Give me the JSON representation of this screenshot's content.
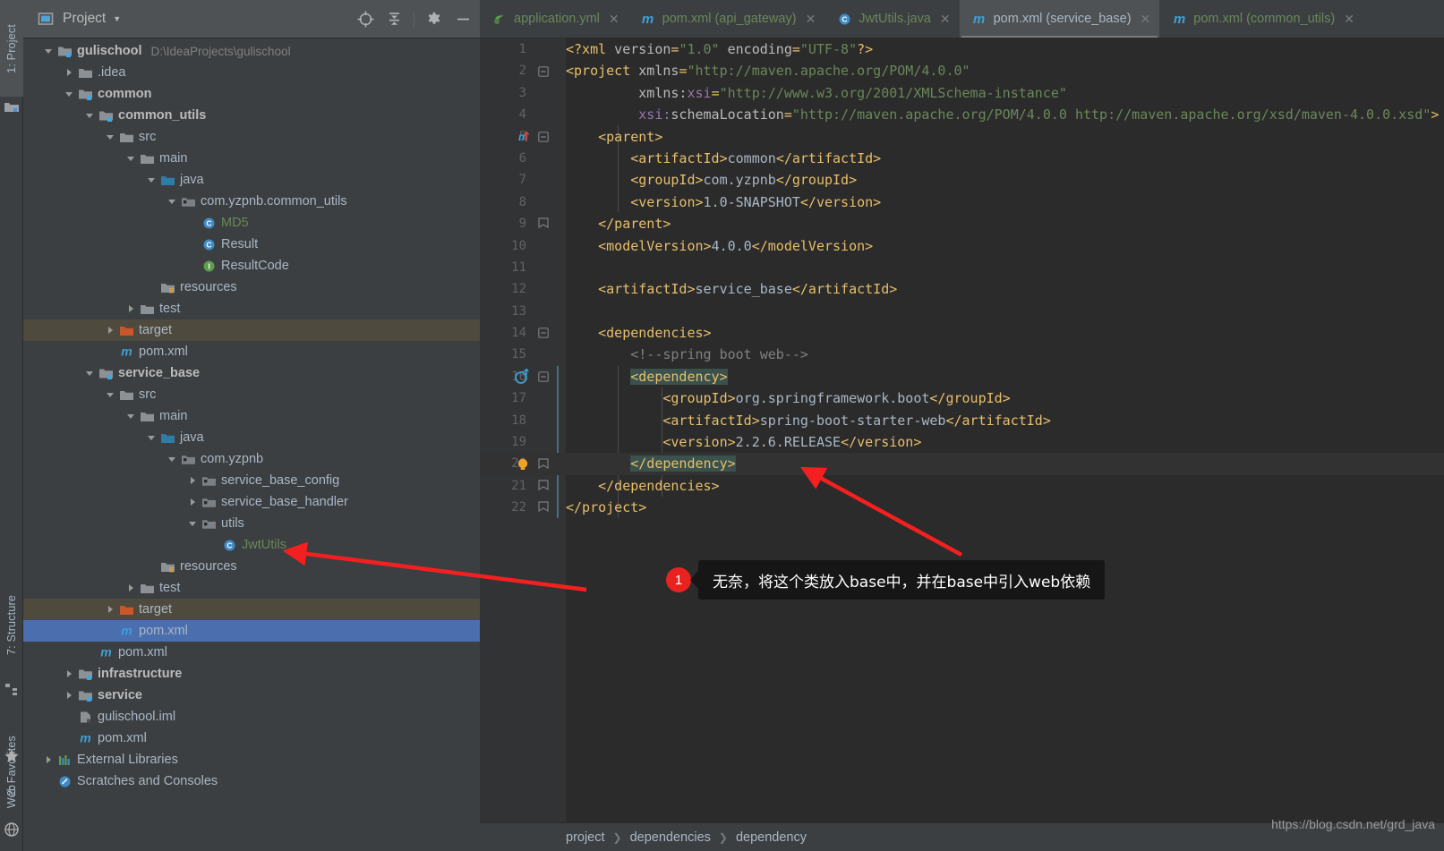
{
  "toolstrip": {
    "tabs": [
      {
        "label": "1: Project",
        "active": true,
        "icon": "project-icon"
      },
      {
        "label": "7: Structure",
        "active": false,
        "icon": "structure-icon"
      },
      {
        "label": "2: Favorites",
        "active": false,
        "icon": "star-icon"
      },
      {
        "label": "Web",
        "active": false,
        "icon": "web-icon"
      }
    ]
  },
  "project_panel": {
    "title": "Project",
    "tools": [
      {
        "name": "locate-icon",
        "title": "Select Opened File"
      },
      {
        "name": "collapse-all-icon",
        "title": "Collapse All"
      },
      {
        "name": "gear-icon",
        "title": "Settings"
      },
      {
        "name": "hide-icon",
        "title": "Hide"
      }
    ],
    "tree": [
      {
        "indent": 0,
        "twist": "open",
        "icon": "module-folder",
        "label": "gulischool",
        "style": "bold",
        "sub": "D:\\IdeaProjects\\gulischool",
        "state": ""
      },
      {
        "indent": 1,
        "twist": "closed",
        "icon": "folder",
        "label": ".idea",
        "style": "",
        "sub": "",
        "state": ""
      },
      {
        "indent": 1,
        "twist": "open",
        "icon": "module-folder",
        "label": "common",
        "style": "bold",
        "sub": "",
        "state": ""
      },
      {
        "indent": 2,
        "twist": "open",
        "icon": "module-folder",
        "label": "common_utils",
        "style": "bold",
        "sub": "",
        "state": ""
      },
      {
        "indent": 3,
        "twist": "open",
        "icon": "folder",
        "label": "src",
        "style": "",
        "sub": "",
        "state": ""
      },
      {
        "indent": 4,
        "twist": "open",
        "icon": "folder",
        "label": "main",
        "style": "",
        "sub": "",
        "state": ""
      },
      {
        "indent": 5,
        "twist": "open",
        "icon": "source-folder",
        "label": "java",
        "style": "",
        "sub": "",
        "state": ""
      },
      {
        "indent": 6,
        "twist": "open",
        "icon": "package",
        "label": "com.yzpnb.common_utils",
        "style": "",
        "sub": "",
        "state": ""
      },
      {
        "indent": 7,
        "twist": "none",
        "icon": "class",
        "label": "MD5",
        "style": "green",
        "sub": "",
        "state": ""
      },
      {
        "indent": 7,
        "twist": "none",
        "icon": "class",
        "label": "Result",
        "style": "",
        "sub": "",
        "state": ""
      },
      {
        "indent": 7,
        "twist": "none",
        "icon": "interface",
        "label": "ResultCode",
        "style": "",
        "sub": "",
        "state": ""
      },
      {
        "indent": 5,
        "twist": "none",
        "icon": "resources-folder",
        "label": "resources",
        "style": "",
        "sub": "",
        "state": ""
      },
      {
        "indent": 4,
        "twist": "closed",
        "icon": "folder",
        "label": "test",
        "style": "",
        "sub": "",
        "state": ""
      },
      {
        "indent": 3,
        "twist": "closed",
        "icon": "excluded-folder",
        "label": "target",
        "style": "",
        "sub": "",
        "state": "highlight"
      },
      {
        "indent": 3,
        "twist": "none",
        "icon": "maven",
        "label": "pom.xml",
        "style": "blue",
        "sub": "",
        "state": ""
      },
      {
        "indent": 2,
        "twist": "open",
        "icon": "module-folder",
        "label": "service_base",
        "style": "bold",
        "sub": "",
        "state": ""
      },
      {
        "indent": 3,
        "twist": "open",
        "icon": "folder",
        "label": "src",
        "style": "",
        "sub": "",
        "state": ""
      },
      {
        "indent": 4,
        "twist": "open",
        "icon": "folder",
        "label": "main",
        "style": "",
        "sub": "",
        "state": ""
      },
      {
        "indent": 5,
        "twist": "open",
        "icon": "source-folder",
        "label": "java",
        "style": "",
        "sub": "",
        "state": ""
      },
      {
        "indent": 6,
        "twist": "open",
        "icon": "package",
        "label": "com.yzpnb",
        "style": "",
        "sub": "",
        "state": ""
      },
      {
        "indent": 7,
        "twist": "closed",
        "icon": "package",
        "label": "service_base_config",
        "style": "",
        "sub": "",
        "state": ""
      },
      {
        "indent": 7,
        "twist": "closed",
        "icon": "package",
        "label": "service_base_handler",
        "style": "",
        "sub": "",
        "state": ""
      },
      {
        "indent": 7,
        "twist": "open",
        "icon": "package",
        "label": "utils",
        "style": "",
        "sub": "",
        "state": ""
      },
      {
        "indent": 8,
        "twist": "none",
        "icon": "class",
        "label": "JwtUtils",
        "style": "green",
        "sub": "",
        "state": ""
      },
      {
        "indent": 5,
        "twist": "none",
        "icon": "resources-folder",
        "label": "resources",
        "style": "",
        "sub": "",
        "state": ""
      },
      {
        "indent": 4,
        "twist": "closed",
        "icon": "folder",
        "label": "test",
        "style": "",
        "sub": "",
        "state": ""
      },
      {
        "indent": 3,
        "twist": "closed",
        "icon": "excluded-folder",
        "label": "target",
        "style": "",
        "sub": "",
        "state": "highlight"
      },
      {
        "indent": 3,
        "twist": "none",
        "icon": "maven",
        "label": "pom.xml",
        "style": "",
        "sub": "",
        "state": "selected"
      },
      {
        "indent": 2,
        "twist": "none",
        "icon": "maven",
        "label": "pom.xml",
        "style": "",
        "sub": "",
        "state": ""
      },
      {
        "indent": 1,
        "twist": "closed",
        "icon": "module-folder",
        "label": "infrastructure",
        "style": "bold",
        "sub": "",
        "state": ""
      },
      {
        "indent": 1,
        "twist": "closed",
        "icon": "module-folder",
        "label": "service",
        "style": "bold",
        "sub": "",
        "state": ""
      },
      {
        "indent": 1,
        "twist": "none",
        "icon": "iml",
        "label": "gulischool.iml",
        "style": "",
        "sub": "",
        "state": ""
      },
      {
        "indent": 1,
        "twist": "none",
        "icon": "maven",
        "label": "pom.xml",
        "style": "",
        "sub": "",
        "state": ""
      },
      {
        "indent": 0,
        "twist": "closed",
        "icon": "libraries",
        "label": "External Libraries",
        "style": "",
        "sub": "",
        "state": ""
      },
      {
        "indent": 0,
        "twist": "none",
        "icon": "scratches",
        "label": "Scratches and Consoles",
        "style": "",
        "sub": "",
        "state": ""
      }
    ]
  },
  "editor": {
    "tabs": [
      {
        "label": "application.yml",
        "icon": "yml-icon",
        "active": false,
        "closable": true
      },
      {
        "label": "pom.xml (api_gateway)",
        "icon": "maven-icon",
        "active": false,
        "closable": true
      },
      {
        "label": "JwtUtils.java",
        "icon": "class-icon",
        "active": false,
        "closable": true
      },
      {
        "label": "pom.xml (service_base)",
        "icon": "maven-icon",
        "active": true,
        "closable": true
      },
      {
        "label": "pom.xml (common_utils)",
        "icon": "maven-icon",
        "active": false,
        "closable": true
      }
    ],
    "breadcrumb": [
      "project",
      "dependencies",
      "dependency"
    ],
    "lines": [
      {
        "n": 1,
        "fold": "",
        "gutter": "",
        "cur": false,
        "tokens": [
          {
            "t": "tag",
            "v": "<?xml"
          },
          {
            "t": "attr",
            "v": " version"
          },
          {
            "t": "tag",
            "v": "="
          },
          {
            "t": "str",
            "v": "\"1.0\""
          },
          {
            "t": "attr",
            "v": " encoding"
          },
          {
            "t": "tag",
            "v": "="
          },
          {
            "t": "str",
            "v": "\"UTF-8\""
          },
          {
            "t": "tag",
            "v": "?>"
          }
        ]
      },
      {
        "n": 2,
        "fold": "open",
        "gutter": "",
        "cur": false,
        "tokens": [
          {
            "t": "tag",
            "v": "<project"
          },
          {
            "t": "attr",
            "v": " xmlns"
          },
          {
            "t": "tag",
            "v": "="
          },
          {
            "t": "str",
            "v": "\"http://maven.apache.org/POM/4.0.0\""
          }
        ]
      },
      {
        "n": 3,
        "fold": "",
        "gutter": "",
        "cur": false,
        "tokens": [
          {
            "t": "txt",
            "v": "         "
          },
          {
            "t": "attr",
            "v": "xmlns:"
          },
          {
            "t": "ns",
            "v": "xsi"
          },
          {
            "t": "tag",
            "v": "="
          },
          {
            "t": "str",
            "v": "\"http://www.w3.org/2001/XMLSchema-instance\""
          }
        ]
      },
      {
        "n": 4,
        "fold": "",
        "gutter": "",
        "cur": false,
        "tokens": [
          {
            "t": "txt",
            "v": "         "
          },
          {
            "t": "ns",
            "v": "xsi:"
          },
          {
            "t": "attr",
            "v": "schemaLocation"
          },
          {
            "t": "tag",
            "v": "="
          },
          {
            "t": "str",
            "v": "\"http://maven.apache.org/POM/4.0.0 http://maven.apache.org/xsd/maven-4.0.0.xsd\""
          },
          {
            "t": "tag",
            "v": ">"
          }
        ]
      },
      {
        "n": 5,
        "fold": "open",
        "gutter": "maven",
        "cur": false,
        "tokens": [
          {
            "t": "txt",
            "v": "    "
          },
          {
            "t": "tag",
            "v": "<parent>"
          }
        ]
      },
      {
        "n": 6,
        "fold": "",
        "gutter": "",
        "cur": false,
        "tokens": [
          {
            "t": "txt",
            "v": "        "
          },
          {
            "t": "tag",
            "v": "<artifactId>"
          },
          {
            "t": "txt",
            "v": "common"
          },
          {
            "t": "tag",
            "v": "</artifactId>"
          }
        ]
      },
      {
        "n": 7,
        "fold": "",
        "gutter": "",
        "cur": false,
        "tokens": [
          {
            "t": "txt",
            "v": "        "
          },
          {
            "t": "tag",
            "v": "<groupId>"
          },
          {
            "t": "txt",
            "v": "com.yzpnb"
          },
          {
            "t": "tag",
            "v": "</groupId>"
          }
        ]
      },
      {
        "n": 8,
        "fold": "",
        "gutter": "",
        "cur": false,
        "tokens": [
          {
            "t": "txt",
            "v": "        "
          },
          {
            "t": "tag",
            "v": "<version>"
          },
          {
            "t": "txt",
            "v": "1.0-SNAPSHOT"
          },
          {
            "t": "tag",
            "v": "</version>"
          }
        ]
      },
      {
        "n": 9,
        "fold": "close",
        "gutter": "",
        "cur": false,
        "tokens": [
          {
            "t": "txt",
            "v": "    "
          },
          {
            "t": "tag",
            "v": "</parent>"
          }
        ]
      },
      {
        "n": 10,
        "fold": "",
        "gutter": "",
        "cur": false,
        "tokens": [
          {
            "t": "txt",
            "v": "    "
          },
          {
            "t": "tag",
            "v": "<modelVersion>"
          },
          {
            "t": "txt",
            "v": "4.0.0"
          },
          {
            "t": "tag",
            "v": "</modelVersion>"
          }
        ]
      },
      {
        "n": 11,
        "fold": "",
        "gutter": "",
        "cur": false,
        "tokens": []
      },
      {
        "n": 12,
        "fold": "",
        "gutter": "",
        "cur": false,
        "tokens": [
          {
            "t": "txt",
            "v": "    "
          },
          {
            "t": "tag",
            "v": "<artifactId>"
          },
          {
            "t": "txt",
            "v": "service_base"
          },
          {
            "t": "tag",
            "v": "</artifactId>"
          }
        ]
      },
      {
        "n": 13,
        "fold": "",
        "gutter": "",
        "cur": false,
        "tokens": []
      },
      {
        "n": 14,
        "fold": "open",
        "gutter": "",
        "cur": false,
        "tokens": [
          {
            "t": "txt",
            "v": "    "
          },
          {
            "t": "tag",
            "v": "<dependencies>"
          }
        ]
      },
      {
        "n": 15,
        "fold": "",
        "gutter": "",
        "cur": false,
        "tokens": [
          {
            "t": "txt",
            "v": "        "
          },
          {
            "t": "com",
            "v": "<!--spring boot web-->"
          }
        ]
      },
      {
        "n": 16,
        "fold": "open",
        "gutter": "depend",
        "cur": false,
        "tokens": [
          {
            "t": "txt",
            "v": "        "
          },
          {
            "t": "hl",
            "v": "<dependency>"
          }
        ]
      },
      {
        "n": 17,
        "fold": "",
        "gutter": "",
        "cur": false,
        "tokens": [
          {
            "t": "txt",
            "v": "            "
          },
          {
            "t": "tag",
            "v": "<groupId>"
          },
          {
            "t": "txt",
            "v": "org.springframework.boot"
          },
          {
            "t": "tag",
            "v": "</groupId>"
          }
        ]
      },
      {
        "n": 18,
        "fold": "",
        "gutter": "",
        "cur": false,
        "tokens": [
          {
            "t": "txt",
            "v": "            "
          },
          {
            "t": "tag",
            "v": "<artifactId>"
          },
          {
            "t": "txt",
            "v": "spring-boot-starter-web"
          },
          {
            "t": "tag",
            "v": "</artifactId>"
          }
        ]
      },
      {
        "n": 19,
        "fold": "",
        "gutter": "",
        "cur": false,
        "tokens": [
          {
            "t": "txt",
            "v": "            "
          },
          {
            "t": "tag",
            "v": "<version>"
          },
          {
            "t": "txt",
            "v": "2.2.6.RELEASE"
          },
          {
            "t": "tag",
            "v": "</version>"
          }
        ]
      },
      {
        "n": 20,
        "fold": "close",
        "gutter": "bulb",
        "cur": true,
        "tokens": [
          {
            "t": "txt",
            "v": "        "
          },
          {
            "t": "hl",
            "v": "</dependency>"
          }
        ]
      },
      {
        "n": 21,
        "fold": "close",
        "gutter": "",
        "cur": false,
        "tokens": [
          {
            "t": "txt",
            "v": "    "
          },
          {
            "t": "tag",
            "v": "</dependencies>"
          }
        ]
      },
      {
        "n": 22,
        "fold": "close",
        "gutter": "",
        "cur": false,
        "tokens": [
          {
            "t": "tag",
            "v": "</project>"
          }
        ]
      }
    ]
  },
  "annotations": [
    {
      "badge": "1",
      "text": "无奈，将这个类放入base中，并在base中引入web依赖"
    }
  ],
  "watermark": "https://blog.csdn.net/grd_java",
  "colors": {
    "panel_bg": "#3C3F41",
    "editor_bg": "#2B2B2B",
    "gutter_bg": "#313335",
    "selection": "#4B6EAF",
    "excluded": "#4E4A3E",
    "accent_red": "#E8231F",
    "tag": "#E8BF6A",
    "string": "#6A8759",
    "comment": "#808080",
    "text": "#A9B7C6"
  }
}
